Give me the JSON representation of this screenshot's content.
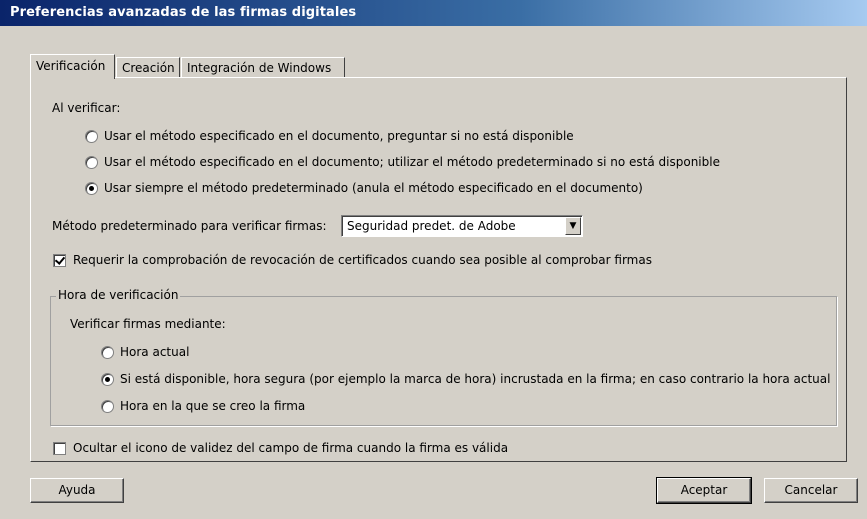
{
  "window": {
    "title": "Preferencias avanzadas de las firmas digitales"
  },
  "tabs": [
    {
      "label": "Verificación",
      "active": true
    },
    {
      "label": "Creación",
      "active": false
    },
    {
      "label": "Integración de Windows",
      "active": false
    }
  ],
  "verification": {
    "heading": "Al verificar:",
    "options": [
      {
        "label": "Usar el método especificado en el documento, preguntar si no está disponible",
        "checked": false
      },
      {
        "label": "Usar el método especificado en el documento; utilizar el método predeterminado si no está disponible",
        "checked": false
      },
      {
        "label": "Usar siempre el método predeterminado (anula el método especificado en el documento)",
        "checked": true
      }
    ],
    "default_method_label": "Método predeterminado para verificar firmas:",
    "default_method_value": "Seguridad predet. de Adobe",
    "revocation_check_label": "Requerir la comprobación de revocación de certificados cuando sea posible al comprobar firmas",
    "revocation_check_checked": true
  },
  "time_group": {
    "title": "Hora de verificación",
    "subheading": "Verificar firmas mediante:",
    "options": [
      {
        "label": "Hora actual",
        "checked": false
      },
      {
        "label": "Si está disponible, hora segura (por ejemplo la marca de hora) incrustada en la firma; en caso contrario la hora actual",
        "checked": true
      },
      {
        "label": "Hora en la que se creo la firma",
        "checked": false
      }
    ]
  },
  "hide_icon": {
    "label": "Ocultar el icono de validez del campo de firma cuando la firma es válida",
    "checked": false
  },
  "buttons": {
    "help": "Ayuda",
    "accept": "Aceptar",
    "cancel": "Cancelar"
  },
  "colors": {
    "face": "#d4d0c8",
    "title_start": "#0a246a",
    "title_end": "#a6caf0"
  }
}
